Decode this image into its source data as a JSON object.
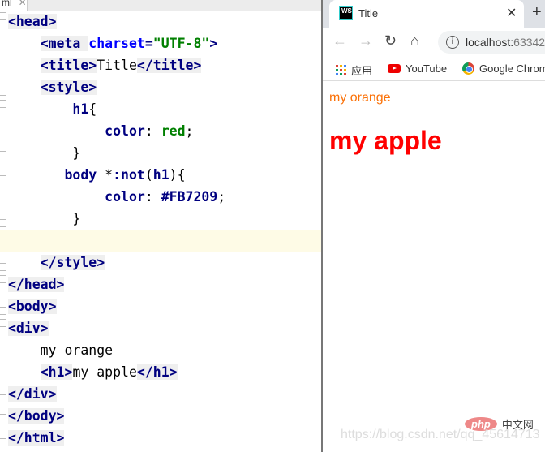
{
  "editor": {
    "tab_label": "ml",
    "lines": [
      [
        [
          "kw",
          "<head>"
        ]
      ],
      [
        [
          "pl",
          "    "
        ],
        [
          "kw",
          "<meta "
        ],
        [
          "at",
          "charset"
        ],
        [
          "kw",
          "="
        ],
        [
          "st",
          "\"UTF-8\""
        ],
        [
          "kw",
          ">"
        ]
      ],
      [
        [
          "pl",
          "    "
        ],
        [
          "kw",
          "<title>"
        ],
        [
          "pl",
          "Title"
        ],
        [
          "kw",
          "</title>"
        ]
      ],
      [
        [
          "pl",
          "    "
        ],
        [
          "kw",
          "<style>"
        ]
      ],
      [
        [
          "pl",
          "        "
        ],
        [
          "kw",
          "h1"
        ],
        [
          "pl",
          "{"
        ]
      ],
      [
        [
          "pl",
          "            "
        ],
        [
          "kw",
          "color"
        ],
        [
          "pl",
          ": "
        ],
        [
          "st",
          "red"
        ],
        [
          "pl",
          ";"
        ]
      ],
      [
        [
          "pl",
          "        }"
        ]
      ],
      [
        [
          "pl",
          "       "
        ],
        [
          "kw",
          "body "
        ],
        [
          "pl",
          "*"
        ],
        [
          "kw",
          ":not"
        ],
        [
          "pl",
          "("
        ],
        [
          "kw",
          "h1"
        ],
        [
          "pl",
          "){"
        ]
      ],
      [
        [
          "pl",
          "            "
        ],
        [
          "kw",
          "color"
        ],
        [
          "pl",
          ": "
        ],
        [
          "kw",
          "#FB7209"
        ],
        [
          "pl",
          ";"
        ]
      ],
      [
        [
          "pl",
          "        }"
        ]
      ],
      [],
      [
        [
          "pl",
          "    "
        ],
        [
          "kw",
          "</style>"
        ]
      ],
      [
        [
          "kw",
          "</head>"
        ]
      ],
      [
        [
          "kw",
          "<body>"
        ]
      ],
      [
        [
          "kw",
          "<div>"
        ]
      ],
      [
        [
          "pl",
          "    my orange"
        ]
      ],
      [
        [
          "pl",
          "    "
        ],
        [
          "kw",
          "<h1>"
        ],
        [
          "pl",
          "my apple"
        ],
        [
          "kw",
          "</h1>"
        ]
      ],
      [
        [
          "kw",
          "</div>"
        ]
      ],
      [
        [
          "kw",
          "</body>"
        ]
      ],
      [
        [
          "kw",
          "</html>"
        ]
      ]
    ]
  },
  "browser": {
    "tab_title": "Title",
    "tab_close": "✕",
    "new_tab": "+",
    "url_host": "localhost:",
    "url_port": "63342",
    "bookmarks": [
      {
        "label": "应用"
      },
      {
        "label": "YouTube"
      },
      {
        "label": "Google Chrome"
      }
    ],
    "page": {
      "text": "my orange",
      "heading": "my apple"
    }
  },
  "watermark": {
    "url": "https://blog.csdn.net/qq_45614713",
    "logo": "php",
    "logo_cn": "中文网"
  },
  "colors": {
    "orange": "#FB7209",
    "red": "#FF0000"
  }
}
